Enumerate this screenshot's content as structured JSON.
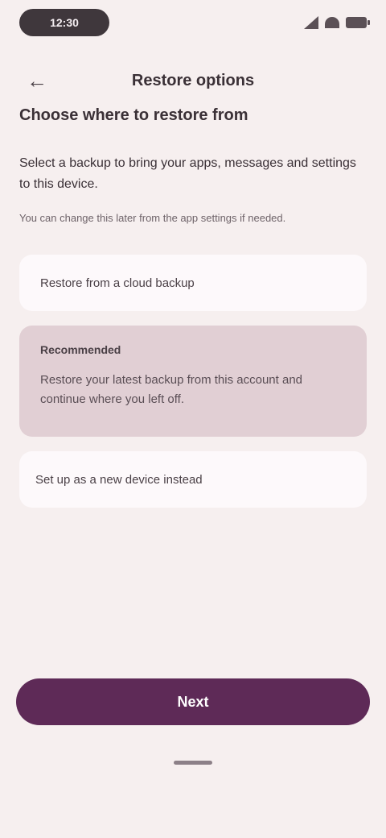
{
  "status_bar": {
    "time": "12:30"
  },
  "top_bar": {
    "back_icon": "arrow-back-icon",
    "title": "Restore options"
  },
  "heading": "Choose where to restore from",
  "description": "Select a backup to bring your apps, messages and settings to this device.",
  "subtext": "You can change this later from the app settings if needed.",
  "options": [
    {
      "label": "Restore from a cloud backup",
      "selected": false
    },
    {
      "label": "Recommended",
      "detail": "Restore your latest backup from this account and continue where you left off.",
      "selected": true
    },
    {
      "label": "Set up as a new device instead",
      "selected": false
    }
  ],
  "primary_button": {
    "label": "Next"
  },
  "colors": {
    "background": "#f6efef",
    "accent": "#5e2a57",
    "selected_option": "#e1cfd4",
    "option": "#fdf9fb"
  }
}
